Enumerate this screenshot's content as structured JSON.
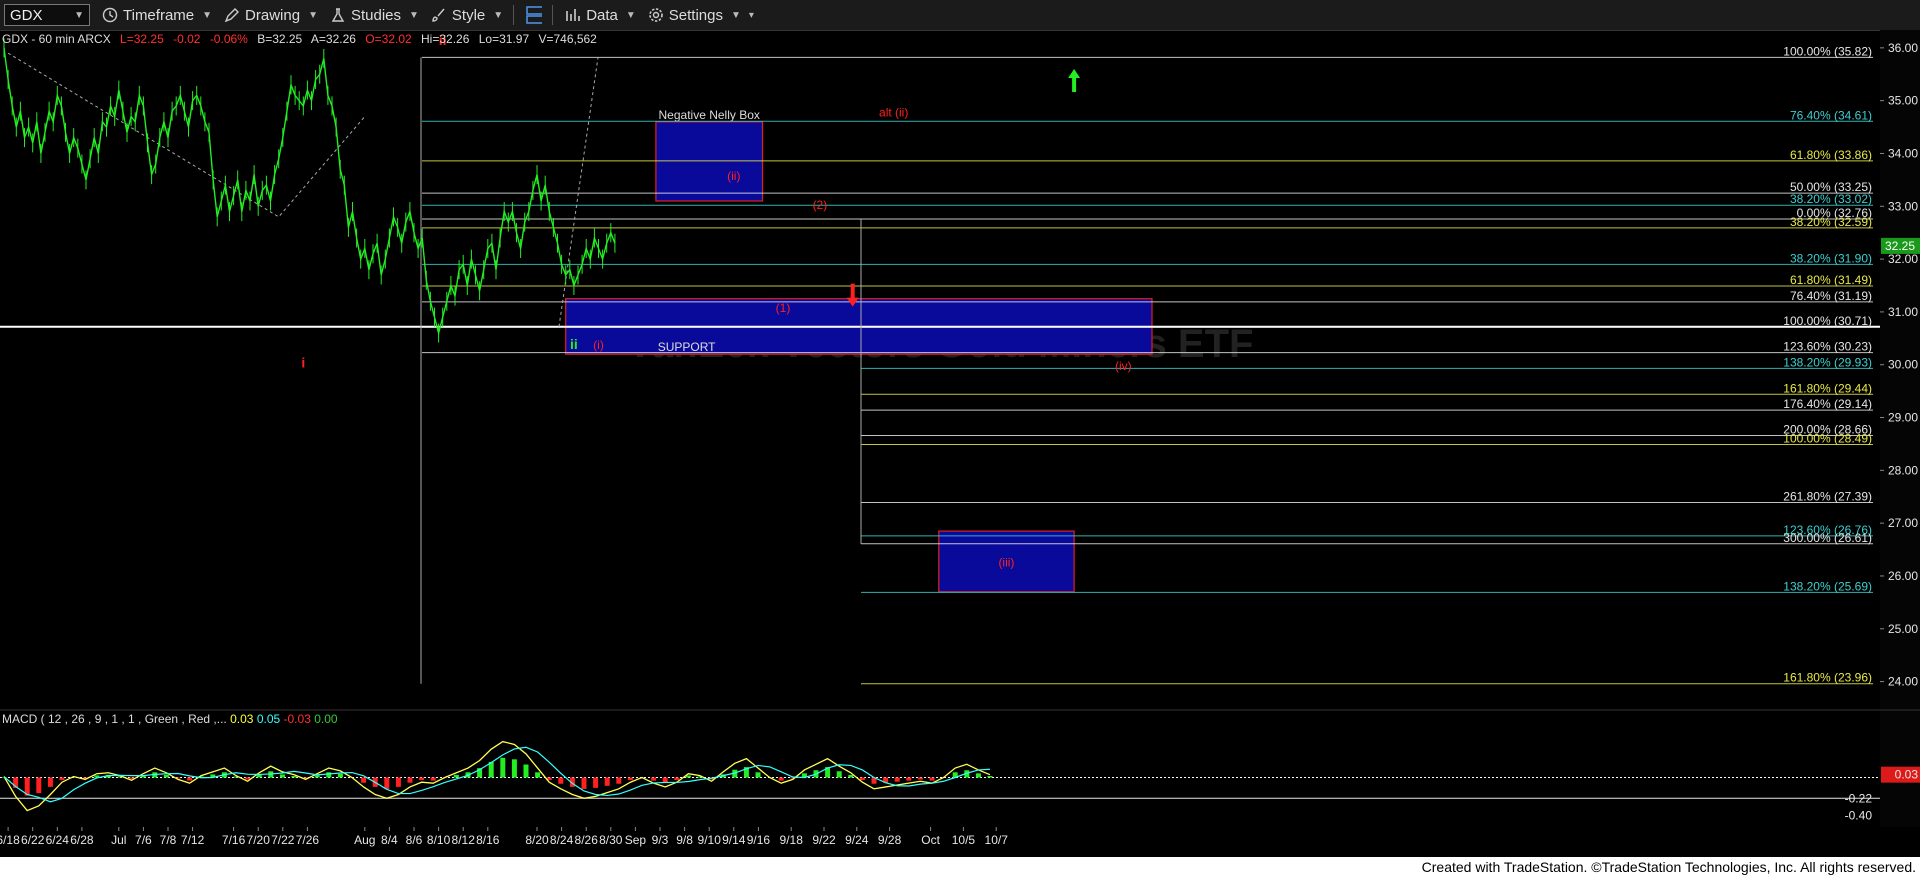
{
  "toolbar": {
    "symbol": "GDX",
    "items": [
      {
        "label": "Timeframe",
        "icon": "clock-icon"
      },
      {
        "label": "Drawing",
        "icon": "pen-icon"
      },
      {
        "label": "Studies",
        "icon": "flask-icon"
      },
      {
        "label": "Style",
        "icon": "brush-icon"
      },
      {
        "label": "",
        "icon": "layout-icon"
      },
      {
        "label": "Data",
        "icon": "bar-chart-icon"
      },
      {
        "label": "Settings",
        "icon": "gear-icon"
      }
    ]
  },
  "info": {
    "symbol_line": "GDX - 60 min  ARCX",
    "last": "L=32.25",
    "chg": "-0.02",
    "pct": "-0.06%",
    "bid": "B=32.25",
    "ask": "A=32.26",
    "open": "O=32.02",
    "high": "Hi=32.26",
    "low": "Lo=31.97",
    "vol": "V=746,562"
  },
  "macd": {
    "label": "MACD ( 12 , 26 , 9 , 1 , 1 , Green , Red ,...",
    "v1": "0.03",
    "v2": "0.05",
    "v3": "-0.03",
    "v4": "0.00",
    "ticks": [
      {
        "v": 0.03,
        "t": "0.03"
      },
      {
        "v": -0.22,
        "t": "-0.22"
      },
      {
        "v": -0.4,
        "t": "-0.40"
      }
    ]
  },
  "credit": "Created with TradeStation. ©TradeStation Technologies, Inc. All rights reserved.",
  "colors": {
    "up": "#22ee22",
    "fib_teal": "#3ccfcf",
    "fib_yellow": "#e8e84a",
    "fib_white": "#e6e6e6",
    "wave_red": "#ff2020",
    "wave_green": "#22ee22",
    "box_fill": "#0a0a9a",
    "box_border": "#e02020"
  },
  "chart_data": {
    "type": "line",
    "title": "",
    "watermark": "VanEck Vectors Gold Miners ETF",
    "x_index_range": [
      0,
      242
    ],
    "ylim": [
      23.5,
      36.3
    ],
    "y_ticks": [
      "36.00",
      "35.00",
      "34.00",
      "33.00",
      "32.00",
      "31.00",
      "30.00",
      "29.00",
      "28.00",
      "27.00",
      "26.00",
      "25.00",
      "24.00"
    ],
    "last_price": "32.25",
    "x_ticks": [
      {
        "i": 1,
        "t": "6/18"
      },
      {
        "i": 7,
        "t": "6/22"
      },
      {
        "i": 13,
        "t": "6/24"
      },
      {
        "i": 19,
        "t": "6/28"
      },
      {
        "i": 28,
        "t": "Jul"
      },
      {
        "i": 34,
        "t": "7/6"
      },
      {
        "i": 40,
        "t": "7/8"
      },
      {
        "i": 46,
        "t": "7/12"
      },
      {
        "i": 56,
        "t": "7/16"
      },
      {
        "i": 62,
        "t": "7/20"
      },
      {
        "i": 68,
        "t": "7/22"
      },
      {
        "i": 74,
        "t": "7/26"
      },
      {
        "i": 88,
        "t": "Aug"
      },
      {
        "i": 94,
        "t": "8/4"
      },
      {
        "i": 100,
        "t": "8/6"
      },
      {
        "i": 106,
        "t": "8/10"
      },
      {
        "i": 112,
        "t": "8/12"
      },
      {
        "i": 118,
        "t": "8/16"
      },
      {
        "i": 130,
        "t": "8/20"
      },
      {
        "i": 136,
        "t": "8/24"
      },
      {
        "i": 142,
        "t": "8/26"
      },
      {
        "i": 148,
        "t": "8/30"
      },
      {
        "i": 154,
        "t": "Sep"
      },
      {
        "i": 160,
        "t": "9/3"
      },
      {
        "i": 166,
        "t": "9/8"
      },
      {
        "i": 172,
        "t": "9/10"
      },
      {
        "i": 178,
        "t": "9/14"
      },
      {
        "i": 184,
        "t": "9/16"
      },
      {
        "i": 192,
        "t": "9/18"
      },
      {
        "i": 200,
        "t": "9/22"
      },
      {
        "i": 208,
        "t": "9/24"
      },
      {
        "i": 216,
        "t": "9/28"
      },
      {
        "i": 226,
        "t": "Oct"
      },
      {
        "i": 234,
        "t": "10/5"
      },
      {
        "i": 242,
        "t": "10/7"
      }
    ],
    "series": [
      {
        "values": [
          36.0,
          35.4,
          34.9,
          34.5,
          34.8,
          34.3,
          34.5,
          34.2,
          34.6,
          34.0,
          34.4,
          34.8,
          34.6,
          35.1,
          34.9,
          34.4,
          34.0,
          34.3,
          34.1,
          33.8,
          33.5,
          33.9,
          34.3,
          34.0,
          34.6,
          34.5,
          34.9,
          34.7,
          35.2,
          34.8,
          34.4,
          34.7,
          34.6,
          35.1,
          34.9,
          34.2,
          33.6,
          33.8,
          34.3,
          34.6,
          34.3,
          34.8,
          34.9,
          35.1,
          34.8,
          34.5,
          35.0,
          35.1,
          34.9,
          34.6,
          34.4,
          33.5,
          32.8,
          33.1,
          33.4,
          32.9,
          33.2,
          33.5,
          32.9,
          33.3,
          33.1,
          33.6,
          33.0,
          33.3,
          33.4,
          33.1,
          33.6,
          33.9,
          34.3,
          34.8,
          35.3,
          35.1,
          35.0,
          34.9,
          35.2,
          35.0,
          35.4,
          35.5,
          35.8,
          35.1,
          34.9,
          34.5,
          33.7,
          33.4,
          32.6,
          32.9,
          32.4,
          32.0,
          32.2,
          31.8,
          32.1,
          32.3,
          31.7,
          32.0,
          32.4,
          32.8,
          32.6,
          32.3,
          32.7,
          32.9,
          32.5,
          32.2,
          32.4,
          31.6,
          31.2,
          30.9,
          30.6,
          30.9,
          31.2,
          31.5,
          31.3,
          31.8,
          31.9,
          31.5,
          32.0,
          31.7,
          31.4,
          31.8,
          32.2,
          32.3,
          31.8,
          32.4,
          32.9,
          32.7,
          32.9,
          32.5,
          32.2,
          32.7,
          32.9,
          33.3,
          33.6,
          33.1,
          33.4,
          32.9,
          32.6,
          32.3,
          31.9,
          31.7,
          31.8,
          31.5,
          31.7,
          31.9,
          32.2,
          32.0,
          32.4,
          32.2,
          32.0,
          32.3,
          32.5,
          32.3
        ],
        "start_index": 0
      }
    ],
    "macd_series": {
      "macd": [
        0.01,
        -0.2,
        -0.35,
        -0.3,
        -0.18,
        -0.05,
        0.01,
        -0.02,
        0.04,
        0.05,
        0.02,
        -0.03,
        0.04,
        0.1,
        0.05,
        -0.02,
        -0.06,
        0.02,
        0.06,
        0.1,
        0.02,
        -0.04,
        0.05,
        0.12,
        0.06,
        0.03,
        -0.02,
        0.04,
        0.1,
        0.07,
        0.0,
        -0.1,
        -0.18,
        -0.22,
        -0.18,
        -0.1,
        -0.05,
        -0.06,
        0.0,
        0.05,
        0.1,
        0.18,
        0.3,
        0.38,
        0.35,
        0.25,
        0.1,
        -0.05,
        -0.12,
        -0.18,
        -0.22,
        -0.2,
        -0.16,
        -0.12,
        -0.05,
        0.0,
        -0.06,
        -0.1,
        -0.05,
        0.04,
        0.02,
        -0.04,
        0.06,
        0.15,
        0.2,
        0.1,
        0.0,
        -0.06,
        -0.02,
        0.08,
        0.14,
        0.2,
        0.12,
        0.05,
        -0.05,
        -0.12,
        -0.1,
        -0.08,
        -0.06,
        -0.04,
        -0.06,
        0.0,
        0.1,
        0.14,
        0.08,
        0.03
      ]
    },
    "fib_levels": [
      {
        "v": 35.82,
        "t": "100.00% (35.82)",
        "c": "#e6e6e6"
      },
      {
        "v": 34.61,
        "t": "76.40% (34.61)",
        "c": "#3ccfcf"
      },
      {
        "v": 33.86,
        "t": "61.80% (33.86)",
        "c": "#e8e84a"
      },
      {
        "v": 33.25,
        "t": "50.00% (33.25)",
        "c": "#e6e6e6"
      },
      {
        "v": 33.02,
        "t": "38.20% (33.02)",
        "c": "#3ccfcf"
      },
      {
        "v": 32.76,
        "t": "0.00% (32.76)",
        "c": "#e6e6e6"
      },
      {
        "v": 32.59,
        "t": "38.20% (32.59)",
        "c": "#e8e84a"
      },
      {
        "v": 31.9,
        "t": "38.20% (31.90)",
        "c": "#3ccfcf"
      },
      {
        "v": 31.49,
        "t": "61.80% (31.49)",
        "c": "#e8e84a"
      },
      {
        "v": 31.19,
        "t": "76.40% (31.19)",
        "c": "#e6e6e6"
      },
      {
        "v": 30.71,
        "t": "100.00% (30.71)",
        "c": "#e6e6e6"
      },
      {
        "v": 30.23,
        "t": "123.60% (30.23)",
        "c": "#e6e6e6"
      },
      {
        "v": 29.93,
        "t": "138.20% (29.93)",
        "c": "#3ccfcf"
      },
      {
        "v": 29.44,
        "t": "161.80% (29.44)",
        "c": "#e8e84a"
      },
      {
        "v": 29.14,
        "t": "176.40% (29.14)",
        "c": "#e6e6e6"
      },
      {
        "v": 28.66,
        "t": "200.00% (28.66)",
        "c": "#e6e6e6"
      },
      {
        "v": 28.49,
        "t": "100.00% (28.49)",
        "c": "#e8e84a"
      },
      {
        "v": 27.39,
        "t": "261.80% (27.39)",
        "c": "#e6e6e6"
      },
      {
        "v": 26.76,
        "t": "123.60% (26.76)",
        "c": "#3ccfcf"
      },
      {
        "v": 26.61,
        "t": "300.00% (26.61)",
        "c": "#e6e6e6"
      },
      {
        "v": 25.69,
        "t": "138.20% (25.69)",
        "c": "#3ccfcf"
      },
      {
        "v": 23.96,
        "t": "161.80% (23.96)",
        "c": "#e8e84a"
      }
    ],
    "boxes": [
      {
        "label": "Negative Nelly Box",
        "i0": 159,
        "i1": 185,
        "v0": 33.1,
        "v1": 34.6
      },
      {
        "label": "SUPPORT",
        "i0": 137,
        "i1": 280,
        "v0": 30.2,
        "v1": 31.25
      },
      {
        "label": "(iii)",
        "i0": 228,
        "i1": 261,
        "v0": 25.7,
        "v1": 26.85
      }
    ],
    "wave_labels": [
      {
        "t": "ii",
        "i": 107,
        "v": 36.05,
        "c": "red"
      },
      {
        "t": "i",
        "i": 73,
        "v": 29.95,
        "c": "red"
      },
      {
        "t": "alt (ii)",
        "i": 217,
        "v": 34.7,
        "c": "red"
      },
      {
        "t": "(ii)",
        "i": 178,
        "v": 33.5,
        "c": "red"
      },
      {
        "t": "(2)",
        "i": 199,
        "v": 32.95,
        "c": "red"
      },
      {
        "t": "(1)",
        "i": 190,
        "v": 31.0,
        "c": "red"
      },
      {
        "t": "(i)",
        "i": 145,
        "v": 30.3,
        "c": "red"
      },
      {
        "t": "ii",
        "i": 139,
        "v": 30.3,
        "c": "green"
      },
      {
        "t": "(iv)",
        "i": 273,
        "v": 29.9,
        "c": "red"
      }
    ],
    "arrows": [
      {
        "dir": "up",
        "i": 261,
        "v": 35.6,
        "c": "green"
      },
      {
        "dir": "down",
        "i": 207,
        "v": 31.1,
        "c": "red"
      }
    ]
  }
}
